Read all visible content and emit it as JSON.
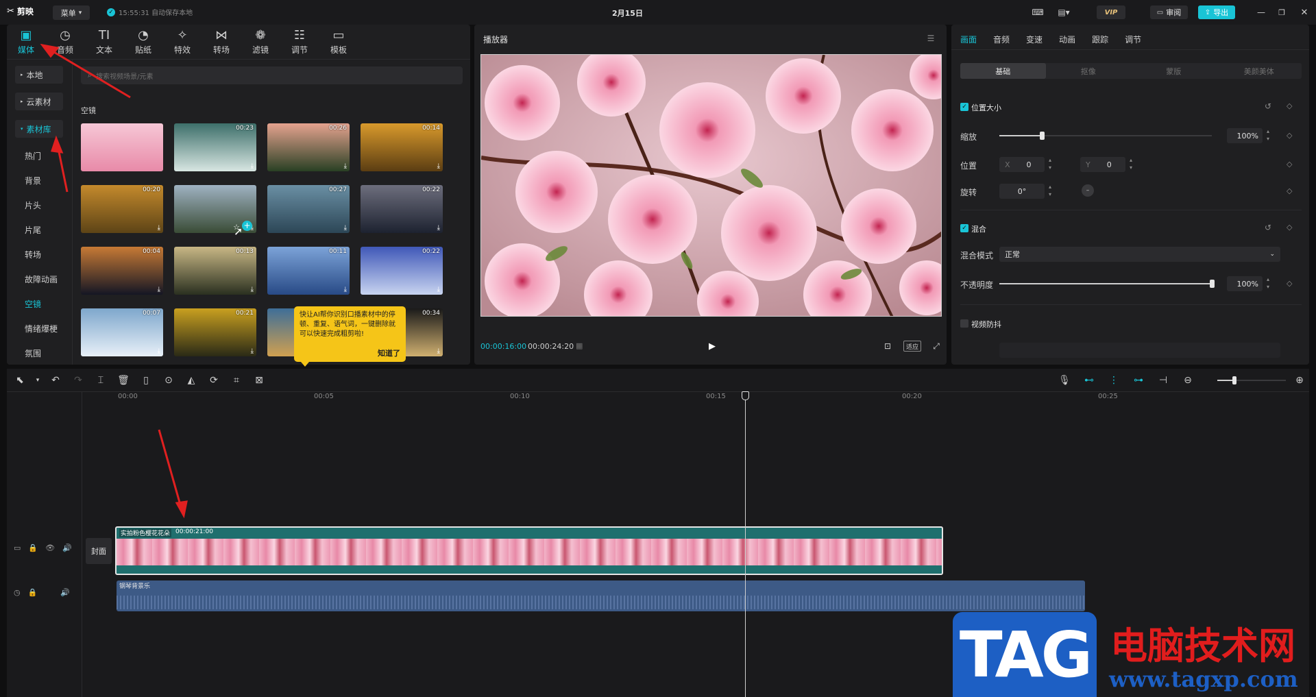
{
  "titlebar": {
    "app_name": "剪映",
    "menu_label": "菜单",
    "autosave": "15:55:31 自动保存本地",
    "project_title": "2月15日",
    "vip_label": "VIP",
    "review_label": "审阅",
    "export_label": "导出"
  },
  "media_tabs": [
    {
      "label": "媒体",
      "icon": "media-icon"
    },
    {
      "label": "音频",
      "icon": "audio-icon"
    },
    {
      "label": "文本",
      "icon": "text-icon"
    },
    {
      "label": "贴纸",
      "icon": "sticker-icon"
    },
    {
      "label": "特效",
      "icon": "effects-icon"
    },
    {
      "label": "转场",
      "icon": "transition-icon"
    },
    {
      "label": "滤镜",
      "icon": "filter-icon"
    },
    {
      "label": "调节",
      "icon": "adjust-icon"
    },
    {
      "label": "模板",
      "icon": "template-icon"
    }
  ],
  "sidebar": {
    "items": [
      {
        "label": "本地"
      },
      {
        "label": "云素材"
      },
      {
        "label": "素材库"
      }
    ],
    "subitems": [
      {
        "label": "热门"
      },
      {
        "label": "背景"
      },
      {
        "label": "片头"
      },
      {
        "label": "片尾"
      },
      {
        "label": "转场"
      },
      {
        "label": "故障动画"
      },
      {
        "label": "空镜"
      },
      {
        "label": "情绪爆梗"
      },
      {
        "label": "氛围"
      }
    ]
  },
  "library": {
    "search_placeholder": "搜索视频场景/元素",
    "section_title": "空镜",
    "thumbs": [
      {
        "dur": "",
        "colors": [
          "#f6c7d6",
          "#e88aa8"
        ]
      },
      {
        "dur": "00:23",
        "colors": [
          "#3d6f6a",
          "#d8e6e2"
        ]
      },
      {
        "dur": "00:26",
        "colors": [
          "#e5a38f",
          "#294024"
        ]
      },
      {
        "dur": "00:14",
        "colors": [
          "#d99a2c",
          "#5b3d12"
        ]
      },
      {
        "dur": "00:20",
        "colors": [
          "#c48a2c",
          "#5d4416"
        ]
      },
      {
        "dur": "",
        "colors": [
          "#9fb2c2",
          "#3a4c36"
        ]
      },
      {
        "dur": "00:27",
        "colors": [
          "#6a8fa4",
          "#2c4656"
        ]
      },
      {
        "dur": "00:22",
        "colors": [
          "#6d6e7d",
          "#1d2230"
        ]
      },
      {
        "dur": "00:04",
        "colors": [
          "#c77a35",
          "#141624"
        ]
      },
      {
        "dur": "00:13",
        "colors": [
          "#c8b785",
          "#2a3020"
        ]
      },
      {
        "dur": "00:11",
        "colors": [
          "#7ca3d8",
          "#284a86"
        ]
      },
      {
        "dur": "00:22",
        "colors": [
          "#4058b8",
          "#c8d4f0"
        ]
      },
      {
        "dur": "00:07",
        "colors": [
          "#7ea7cc",
          "#e8f0f8"
        ]
      },
      {
        "dur": "00:21",
        "colors": [
          "#c9a020",
          "#2a2a16"
        ]
      },
      {
        "dur": "",
        "colors": [
          "#3e6e98",
          "#d0a050"
        ]
      },
      {
        "dur": "00:34",
        "colors": [
          "#1a1a1a",
          "#d0b070"
        ]
      }
    ],
    "tip_text": "快让AI帮你识别口播素材中的停顿、重复、语气词，一键删除就可以快速完成粗剪啦!",
    "tip_button": "知道了"
  },
  "player": {
    "title": "播放器",
    "current_time": "00:00:16:00",
    "total_time": "00:00:24:20",
    "ratio_label": "适应"
  },
  "inspector": {
    "tabs": [
      "画面",
      "音频",
      "变速",
      "动画",
      "跟踪",
      "调节"
    ],
    "subtabs": [
      "基础",
      "抠像",
      "蒙版",
      "美颜美体"
    ],
    "section_position": "位置大小",
    "scale_label": "缩放",
    "scale_value": "100%",
    "scale_level": 0.2,
    "position_label": "位置",
    "x_label": "X",
    "x_value": "0",
    "y_label": "Y",
    "y_value": "0",
    "rotate_label": "旋转",
    "rotate_value": "0°",
    "section_blend": "混合",
    "blend_mode_label": "混合模式",
    "blend_mode_value": "正常",
    "opacity_label": "不透明度",
    "opacity_value": "100%",
    "opacity_level": 1.0,
    "section_stabilize": "视频防抖"
  },
  "timeline": {
    "ruler": [
      "00:00",
      "00:05",
      "00:10",
      "00:15",
      "00:20",
      "00:25"
    ],
    "cover_label": "封面",
    "video_clip_title": "实拍粉色樱花花朵",
    "video_clip_duration": "00:00:21:00",
    "audio_clip_title": "钢琴背景乐"
  },
  "watermark": {
    "tag": "TAG",
    "site_cn": "电脑技术网",
    "url": "www.tagxp.com"
  },
  "colors": {
    "accent": "#19c4d6",
    "annotation": "#e02020",
    "clip_teal": "#1f6f6e",
    "audio_clip": "#3d5a86",
    "tooltip": "#f5c518"
  }
}
